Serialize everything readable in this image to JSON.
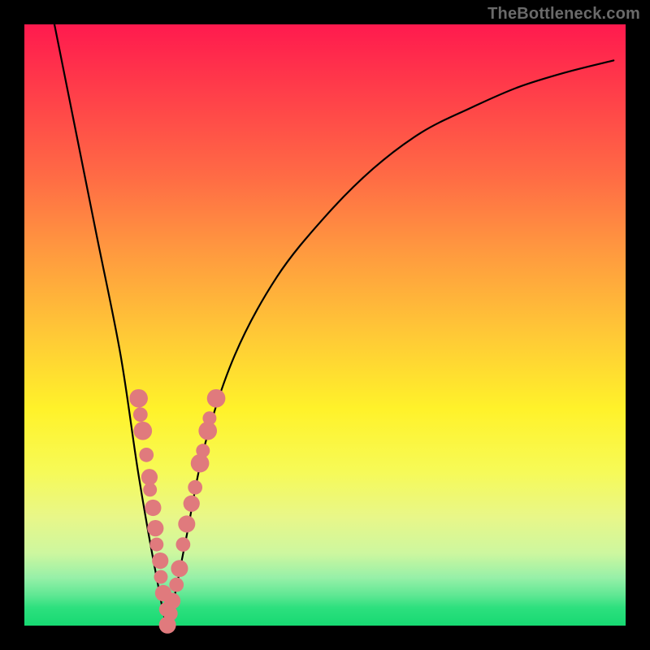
{
  "attribution": "TheBottleneck.com",
  "colors": {
    "bead": "#e07a7d",
    "curve": "#000000",
    "frame_bg_top": "#ff1a4e",
    "frame_bg_bottom": "#17d972"
  },
  "chart_data": {
    "type": "line",
    "title": "",
    "xlabel": "",
    "ylabel": "",
    "xlim": [
      0,
      100
    ],
    "ylim": [
      0,
      100
    ],
    "grid": false,
    "legend": false,
    "note": "Axes are unlabeled in the source image. x and y values below are estimated from pixel positions, interpreted as 0–100 normalized coordinates (y=0 at bottom, y=100 at top).",
    "series": [
      {
        "name": "bottleneck-curve",
        "x": [
          5,
          8,
          12,
          16,
          19,
          22,
          23.8,
          25,
          27,
          30,
          35,
          42,
          50,
          58,
          66,
          74,
          82,
          90,
          98
        ],
        "y": [
          100,
          85,
          65,
          45,
          25,
          8,
          0,
          5,
          15,
          30,
          45,
          58,
          68,
          76,
          82,
          86,
          89.5,
          92,
          94
        ]
      }
    ],
    "markers": {
      "name": "beads",
      "note": "Pink rounded dots along the lower part of both curve arms near the minimum.",
      "points": [
        {
          "x": 19.0,
          "y": 37.8,
          "r": 1.8
        },
        {
          "x": 19.3,
          "y": 35.1,
          "r": 1.2
        },
        {
          "x": 19.7,
          "y": 32.4,
          "r": 1.8
        },
        {
          "x": 20.3,
          "y": 28.4,
          "r": 1.2
        },
        {
          "x": 20.8,
          "y": 24.7,
          "r": 1.5
        },
        {
          "x": 20.9,
          "y": 22.6,
          "r": 1.1
        },
        {
          "x": 21.4,
          "y": 19.6,
          "r": 1.5
        },
        {
          "x": 21.8,
          "y": 16.2,
          "r": 1.5
        },
        {
          "x": 22.0,
          "y": 13.5,
          "r": 1.1
        },
        {
          "x": 22.6,
          "y": 10.8,
          "r": 1.5
        },
        {
          "x": 22.7,
          "y": 8.1,
          "r": 1.1
        },
        {
          "x": 23.1,
          "y": 5.4,
          "r": 1.5
        },
        {
          "x": 23.6,
          "y": 2.7,
          "r": 1.2
        },
        {
          "x": 23.8,
          "y": 0.1,
          "r": 1.6
        },
        {
          "x": 24.3,
          "y": 2.0,
          "r": 1.2
        },
        {
          "x": 24.6,
          "y": 4.1,
          "r": 1.5
        },
        {
          "x": 25.3,
          "y": 6.8,
          "r": 1.2
        },
        {
          "x": 25.8,
          "y": 9.5,
          "r": 1.6
        },
        {
          "x": 26.4,
          "y": 13.5,
          "r": 1.2
        },
        {
          "x": 27.0,
          "y": 16.9,
          "r": 1.6
        },
        {
          "x": 27.8,
          "y": 20.3,
          "r": 1.5
        },
        {
          "x": 28.4,
          "y": 23.0,
          "r": 1.2
        },
        {
          "x": 29.2,
          "y": 27.0,
          "r": 1.8
        },
        {
          "x": 29.7,
          "y": 29.1,
          "r": 1.1
        },
        {
          "x": 30.5,
          "y": 32.4,
          "r": 1.8
        },
        {
          "x": 30.8,
          "y": 34.5,
          "r": 1.1
        },
        {
          "x": 31.9,
          "y": 37.8,
          "r": 1.8
        }
      ]
    }
  }
}
